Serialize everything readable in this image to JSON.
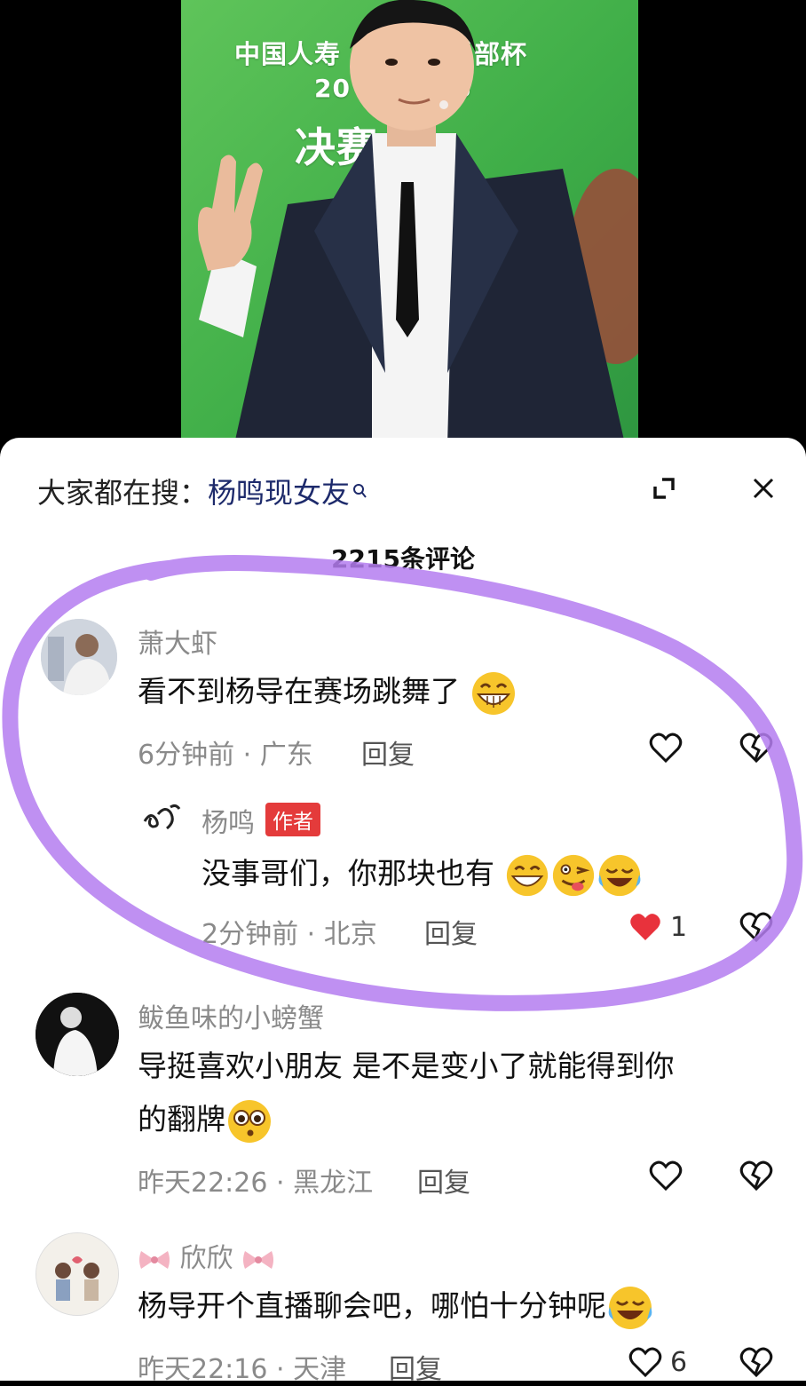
{
  "video": {
    "banner_line1": "中国人寿　　　俱乐部杯",
    "banner_line2": "20　　　　6",
    "banner_line3": "决赛　　"
  },
  "panel": {
    "search_prefix": "大家都在搜：",
    "search_query": "杨鸣现女友",
    "comment_count": "2215条评论"
  },
  "comments": [
    {
      "username": "萧大虾",
      "text": "看不到杨导在赛场跳舞了",
      "time_location": "6分钟前 · 广东",
      "reply_label": "回复",
      "emoji": "grin-icon",
      "reply": {
        "username": "杨鸣",
        "badge": "作者",
        "text": "没事哥们，你那块也有",
        "time_location": "2分钟前 · 北京",
        "reply_label": "回复",
        "likes": "1",
        "liked": true,
        "emojis": [
          "grin-icon",
          "wink-tongue-icon",
          "laugh-cry-icon"
        ]
      }
    },
    {
      "username": "鲅鱼味的小螃蟹",
      "text_line1": "导挺喜欢小朋友 是不是变小了就能得到你",
      "text_line2": "的翻牌",
      "time_location": "昨天22:26 · 黑龙江",
      "reply_label": "回复",
      "emoji": "pleading-icon"
    },
    {
      "username": "欣欣",
      "text": "杨导开个直播聊会吧，哪怕十分钟呢",
      "time_location": "昨天22:16 · 天津",
      "reply_label": "回复",
      "likes": "6",
      "emoji": "laugh-cry-icon"
    }
  ],
  "colors": {
    "accent_like": "#e8323c",
    "annotation_stroke": "#b47cf0",
    "badge_bg": "#e43b3b",
    "video_green": "#3fae48"
  }
}
